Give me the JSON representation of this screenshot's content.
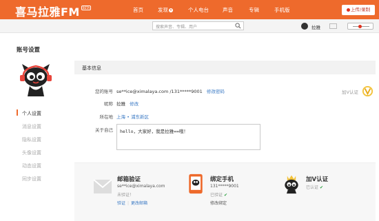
{
  "brand": {
    "logo_text": "喜马拉雅FM",
    "badge": "BETA"
  },
  "nav": {
    "items": [
      {
        "label": "首页"
      },
      {
        "label": "发现"
      },
      {
        "label": "个人电台"
      },
      {
        "label": "声音"
      },
      {
        "label": "专辑"
      },
      {
        "label": "手机版"
      }
    ],
    "upload_label": "上传/录制"
  },
  "search": {
    "placeholder": "搜索声音、专辑、用户"
  },
  "user_bar": {
    "username": "拉雅"
  },
  "sidebar": {
    "heading": "账号设置",
    "items": [
      {
        "label": "个人设置",
        "active": true
      },
      {
        "label": "消息设置",
        "active": false
      },
      {
        "label": "隐私设置",
        "active": false
      },
      {
        "label": "头像设置",
        "active": false
      },
      {
        "label": "动态设置",
        "active": false
      },
      {
        "label": "同步设置",
        "active": false
      }
    ]
  },
  "basic": {
    "title": "基本信息",
    "account": {
      "label": "您的账号",
      "value": "se**ice@ximalaya.com /131*****9001",
      "action": "修改密码"
    },
    "nickname": {
      "label": "昵称",
      "value": "拉雅",
      "action": "修改"
    },
    "location": {
      "label": "所在地",
      "value": "上海 • 浦东新区"
    },
    "about": {
      "label": "关于自己",
      "value": "hello，大家好，我是拉雅==哦！"
    },
    "verify_v": {
      "label": "加V认证"
    }
  },
  "cards": {
    "email": {
      "title": "邮箱验证",
      "value": "se**ice@ximalaya.com",
      "status": "未验证！",
      "action1": "验证",
      "action2": "更改邮箱"
    },
    "phone": {
      "title": "绑定手机",
      "value": "131*****9001",
      "status": "已验证",
      "action": "修改绑定"
    },
    "vcert": {
      "title": "加V认证",
      "status": "已认证"
    }
  },
  "colors": {
    "brand_orange": "#ee6a2c",
    "link_blue": "#3a79c4",
    "verified_green": "#2aa140"
  }
}
